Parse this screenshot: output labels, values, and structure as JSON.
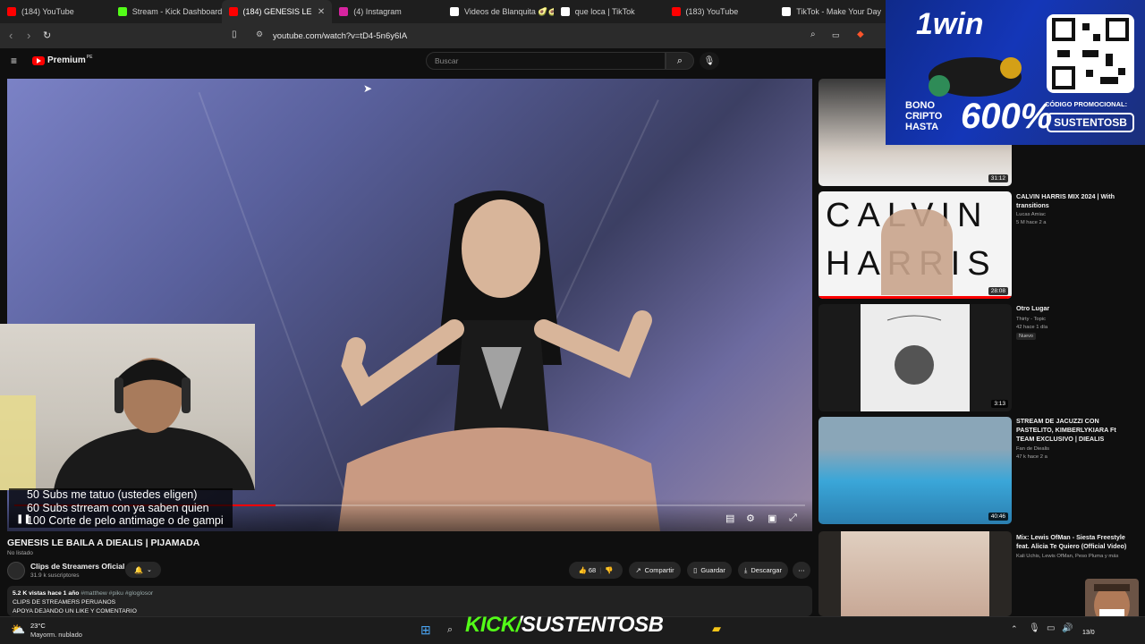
{
  "browser": {
    "tabs": [
      {
        "label": "(184) YouTube",
        "color": "#ff0000",
        "active": false
      },
      {
        "label": "Stream - Kick Dashboard",
        "color": "#53fc18",
        "active": false
      },
      {
        "label": "(184) GENESIS LE",
        "color": "#ff0000",
        "active": true
      },
      {
        "label": "(4) Instagram",
        "color": "#d6249f",
        "active": false
      },
      {
        "label": "Videos de Blanquita 🥑🥑",
        "color": "#ffffff",
        "active": false
      },
      {
        "label": "que loca | TikTok",
        "color": "#ffffff",
        "active": false
      },
      {
        "label": "(183) YouTube",
        "color": "#ff0000",
        "active": false
      },
      {
        "label": "TikTok - Make Your Day",
        "color": "#ffffff",
        "active": false
      }
    ],
    "url": "youtube.com/watch?v=tD4-5n6y6IA"
  },
  "youtube": {
    "logo_text": "Premium",
    "logo_badge": "PE",
    "search_placeholder": "Buscar"
  },
  "video": {
    "progress_fraction": 0.33,
    "subtitle_lines": [
      "50 Subs me tatuo (ustedes eligen)",
      "60 Subs strream con ya saben quien",
      "100 Corte de pelo antimage o de gampi"
    ],
    "title": "GENESIS LE BAILA A DIEALIS | PIJAMADA",
    "unlisted": "No listado",
    "channel_name": "Clips de Streamers Oficial",
    "channel_subs": "31.9 k suscriptores",
    "likes": "68",
    "share_label": "Compartir",
    "save_label": "Guardar",
    "download_label": "Descargar",
    "description": {
      "meta": "5.2 K vistas  hace 1 año",
      "tags": "#matthew #piku #gloglosor",
      "line1": "CLIPS DE STREAMERS PERUANOS",
      "line2": "APOYA DEJANDO UN LIKE Y COMENTARIO"
    }
  },
  "sidebar": [
    {
      "duration": "31:12",
      "title": "",
      "channel": "",
      "meta": ""
    },
    {
      "duration": "28:08",
      "title": "CALVIN HARRIS MIX 2024 | With transitions",
      "channel": "Lucas Amiac",
      "meta": "5 M  hace 2 a",
      "thumb_text1": "CALVIN",
      "thumb_text2": "HARRIS"
    },
    {
      "duration": "3:13",
      "title": "Otro Lugar",
      "channel": "Thirty - Topic",
      "meta": "42  hace 1 día",
      "badge": "Nuevo"
    },
    {
      "duration": "40:46",
      "title": "STREAM DE JACUZZI CON PASTELITO, KIMBERLYKIARA Ft TEAM EXCLUSIVO | DIEALIS",
      "channel": "Fan de Diealis",
      "meta": "47 k  hace 2 a"
    },
    {
      "duration": "",
      "title": "Mix: Lewis OfMan - Siesta Freestyle feat. Alicia Te Quiero (Official Video)",
      "channel": "Kali Uchis, Lewis OfMan, Peso Pluma y más",
      "meta": ""
    }
  ],
  "ad": {
    "logo": "1win",
    "bono": [
      "BONO",
      "CRIPTO",
      "HASTA"
    ],
    "percent": "600%",
    "promo_label": "CÓDIGO PROMOCIONAL:",
    "promo_code": "SUSTENTOSB"
  },
  "taskbar": {
    "temp": "23°C",
    "weather": "Mayorm. nublado",
    "banner": "KICK/SUSTENTOSB",
    "date": "13/0"
  }
}
